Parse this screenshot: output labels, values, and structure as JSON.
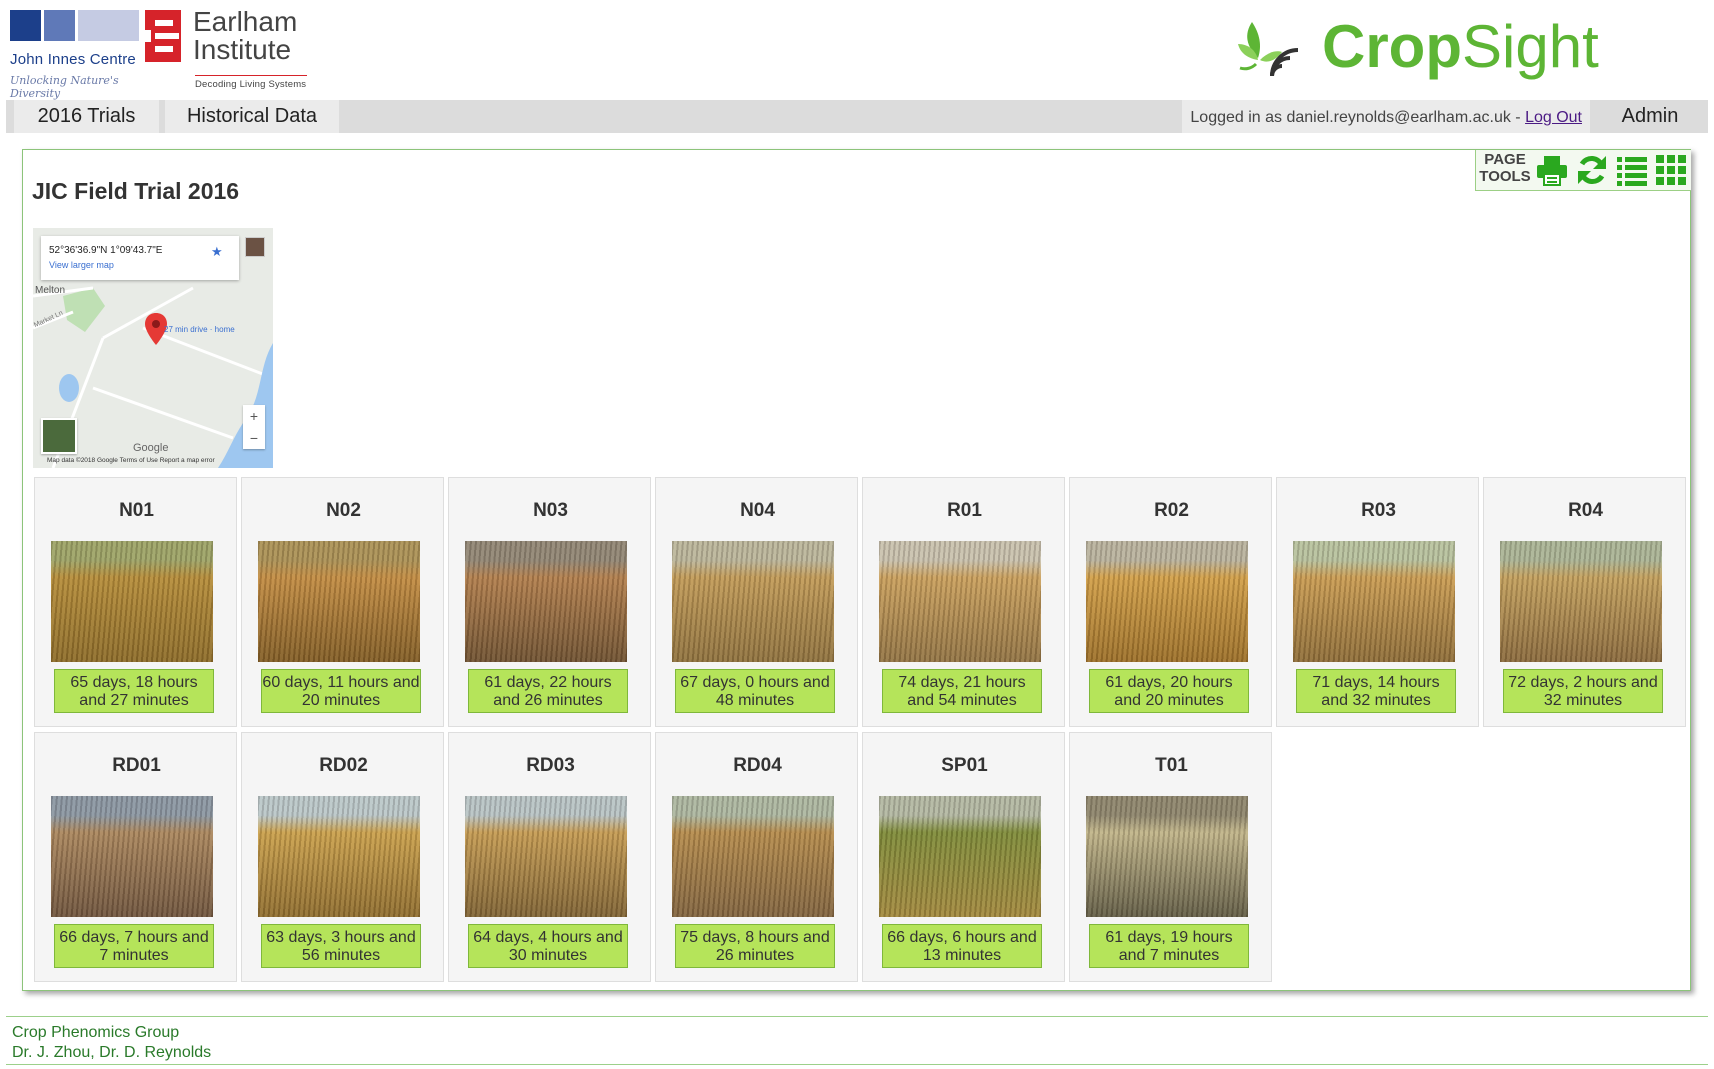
{
  "header": {
    "jic_name": "John Innes Centre",
    "jic_tagline": "Unlocking Nature's Diversity",
    "ei_line1": "Earlham",
    "ei_line2": "Institute",
    "ei_tagline": "Decoding Living Systems",
    "cropsight_bold": "Crop",
    "cropsight_light": "Sight"
  },
  "nav": {
    "tabs": [
      {
        "label": "2016 Trials"
      },
      {
        "label": "Historical Data"
      }
    ],
    "login_prefix": "Logged in as daniel.reynolds@earlham.ac.uk - ",
    "logout_label": "Log Out",
    "admin_label": "Admin"
  },
  "page": {
    "title": "JIC Field Trial 2016",
    "tools_label_1": "PAGE",
    "tools_label_2": "TOOLS",
    "tools": [
      "print-icon",
      "refresh-icon",
      "list-view-icon",
      "grid-view-icon"
    ],
    "accent_color": "#2aa81f"
  },
  "map": {
    "coords": "52°36'36.9\"N 1°09'43.7\"E",
    "larger_map_link": "View larger map",
    "place_label": "Melton",
    "road_label": "Market Ln",
    "drive_label": "27 min drive · home",
    "brand": "Google",
    "footer": "Map data ©2018 Google   Terms of Use   Report a map error",
    "zoom_in": "+",
    "zoom_out": "−"
  },
  "plots": [
    {
      "name": "N01",
      "age": "65 days, 18 hours and 27 minutes"
    },
    {
      "name": "N02",
      "age": "60 days, 11 hours and 20 minutes"
    },
    {
      "name": "N03",
      "age": "61 days, 22 hours and 26 minutes"
    },
    {
      "name": "N04",
      "age": "67 days, 0 hours and 48 minutes"
    },
    {
      "name": "R01",
      "age": "74 days, 21 hours and 54 minutes"
    },
    {
      "name": "R02",
      "age": "61 days, 20 hours and 20 minutes"
    },
    {
      "name": "R03",
      "age": "71 days, 14 hours and 32 minutes"
    },
    {
      "name": "R04",
      "age": "72 days, 2 hours and 32 minutes"
    },
    {
      "name": "RD01",
      "age": "66 days, 7 hours and 7 minutes"
    },
    {
      "name": "RD02",
      "age": "63 days, 3 hours and 56 minutes"
    },
    {
      "name": "RD03",
      "age": "64 days, 4 hours and 30 minutes"
    },
    {
      "name": "RD04",
      "age": "75 days, 8 hours and 26 minutes"
    },
    {
      "name": "SP01",
      "age": "66 days, 6 hours and 13 minutes"
    },
    {
      "name": "T01",
      "age": "61 days, 19 hours and 7 minutes"
    }
  ],
  "footer": {
    "line1": "Crop Phenomics Group",
    "line2": "Dr. J. Zhou, Dr. D. Reynolds"
  }
}
